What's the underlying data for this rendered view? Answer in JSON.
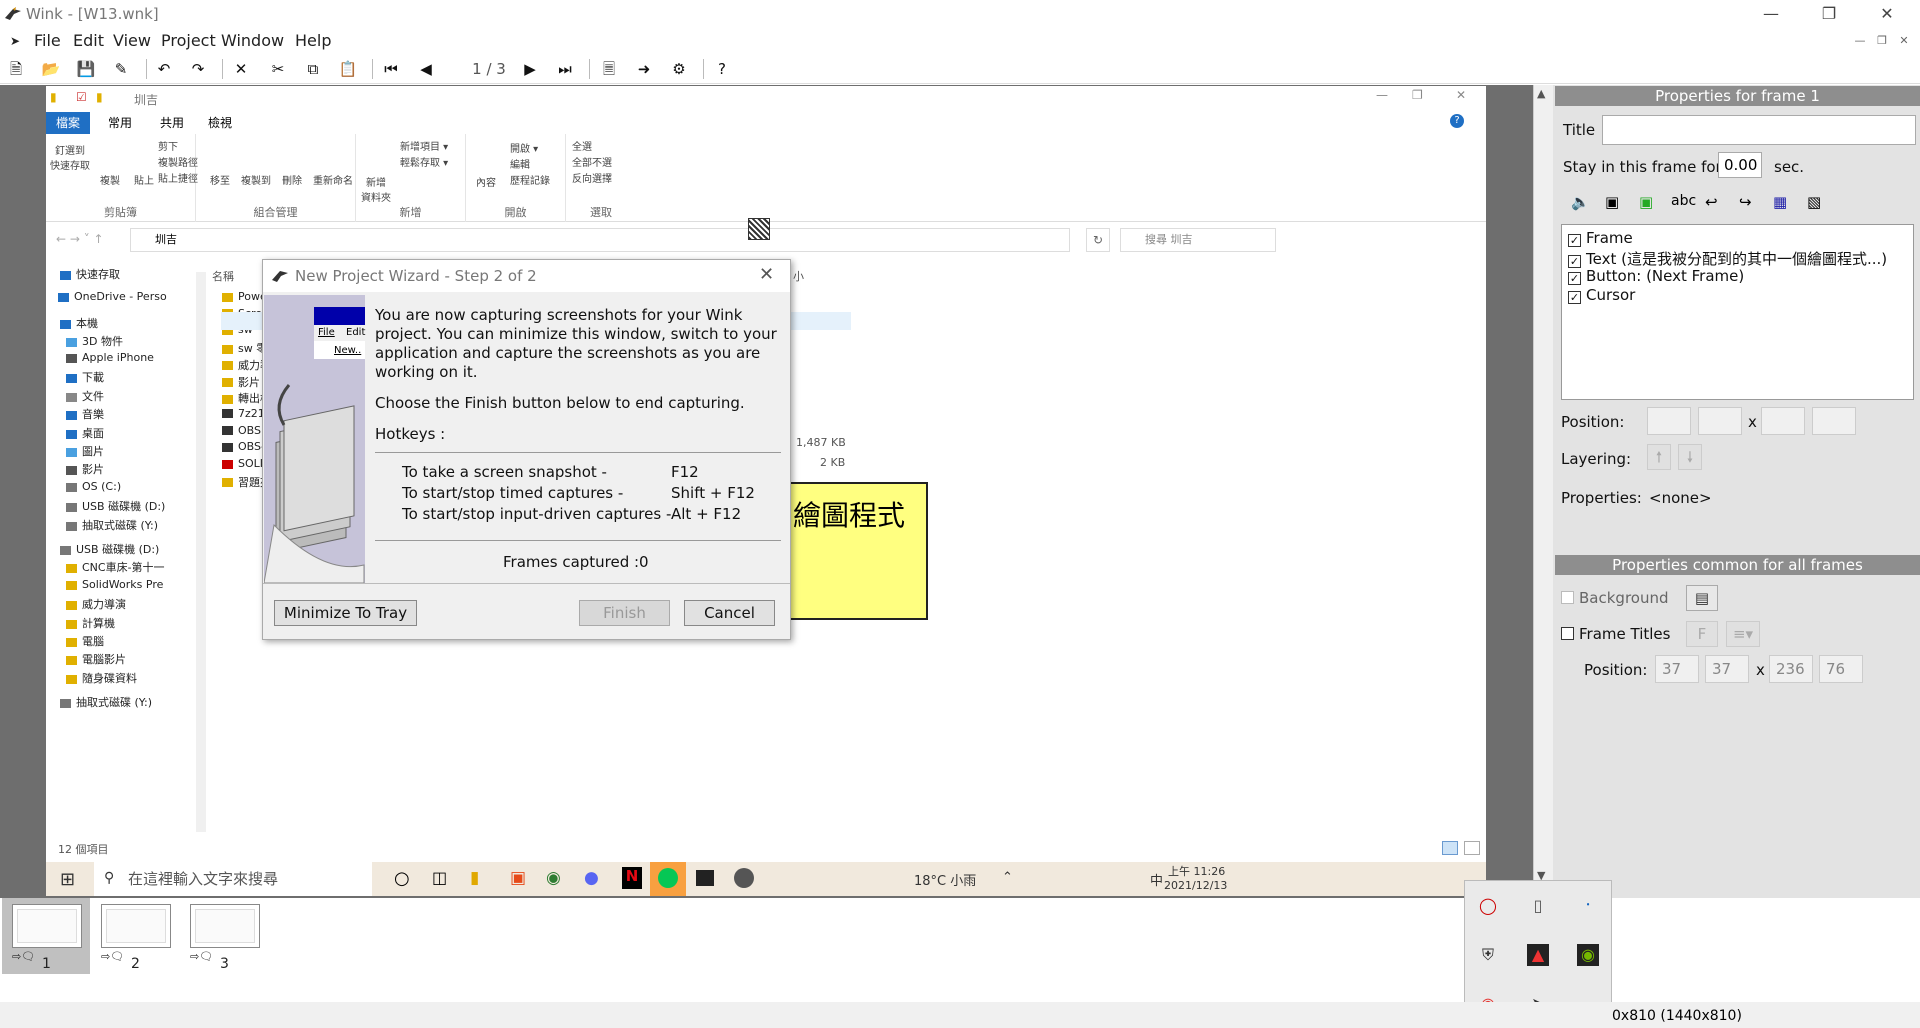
{
  "app": {
    "title": "Wink - [W13.wnk]",
    "menu": [
      "File",
      "Edit",
      "View",
      "Project",
      "Window",
      "Help"
    ],
    "frame_counter": "1 / 3"
  },
  "explorer": {
    "path_title": "圳吉",
    "tabs": [
      "檔案",
      "常用",
      "共用",
      "檢視"
    ],
    "ribbon": {
      "clipboard": {
        "label": "剪貼簿",
        "pin": "釘選到\n快速存取",
        "copy": "複製",
        "paste": "貼上",
        "cut": "剪下",
        "copy_path": "複製路徑",
        "paste_shortcut": "貼上捷徑"
      },
      "organize": {
        "label": "組合管理",
        "move_to": "移至",
        "copy_to": "複製到",
        "delete": "刪除",
        "rename": "重新命名"
      },
      "new": {
        "label": "新增",
        "new_folder": "新增\n資料夾",
        "new_item": "新增項目 ▾",
        "easy_access": "輕鬆存取 ▾"
      },
      "open": {
        "label": "開啟",
        "properties": "內容",
        "open": "開啟 ▾",
        "edit": "編輯",
        "history": "歷程記錄"
      },
      "select": {
        "label": "選取",
        "select_all": "全選",
        "select_none": "全部不選",
        "invert": "反向選擇"
      }
    },
    "address": "圳吉",
    "search_placeholder": "搜尋 圳吉",
    "column_name": "名稱",
    "column_size": "小",
    "nav": [
      "快速存取",
      "OneDrive - Perso",
      "本機",
      "3D 物件",
      "Apple iPhone",
      "下載",
      "文件",
      "音樂",
      "桌面",
      "圖片",
      "影片",
      "OS (C:)",
      "USB 磁碟機 (D:)",
      "抽取式磁碟 (Y:)",
      "USB 磁碟機 (D:)",
      "CNC車床-第十一",
      "SolidWorks Pre",
      "威力導演",
      "計算機",
      "電腦",
      "電腦影片",
      "隨身碟資料",
      "抽取式磁碟 (Y:)"
    ],
    "files": [
      "Powe",
      "Scree",
      "sw",
      "sw 零",
      "威力導",
      "影片",
      "轉出檔",
      "7z210",
      "OBS S",
      "OBS-",
      "SOLID",
      "習題夾"
    ],
    "sizes": [
      "1,487 KB",
      "2 KB"
    ],
    "item_count": "12 個項目"
  },
  "wizard": {
    "title": "New Project Wizard - Step 2 of 2",
    "para1": "You are now capturing screenshots for your Wink project. You can minimize this window, switch to your application and capture the screenshots as you are working on it.",
    "para2": "Choose the Finish button below to end capturing.",
    "hotkeys_label": "Hotkeys :",
    "hotkeys": [
      {
        "action": "To take a screen snapshot -",
        "key": "F12"
      },
      {
        "action": "To start/stop timed captures -",
        "key": "Shift + F12"
      },
      {
        "action": "To start/stop input-driven captures -",
        "key": "Alt + F12"
      }
    ],
    "frames_label": "Frames captured :",
    "frames_value": "0",
    "buttons": {
      "minimize": "Minimize To Tray",
      "finish": "Finish",
      "cancel": "Cancel"
    },
    "side_menu": [
      "File",
      "Edit",
      "New.."
    ]
  },
  "note_text": "繪圖程式",
  "taskbar": {
    "search_placeholder": "在這裡輸入文字來搜尋",
    "weather": "18°C 小雨",
    "ime": "中",
    "time": "上午 11:26",
    "date": "2021/12/13"
  },
  "panel": {
    "frame_header": "Properties for frame 1",
    "title_label": "Title",
    "title_value": "",
    "stay_label": "Stay in this frame for",
    "stay_value": "0.00",
    "stay_unit": "sec.",
    "items": [
      {
        "label": "Frame",
        "checked": true
      },
      {
        "label": "Text (這是我被分配到的其中一個繪圖程式...)",
        "checked": true
      },
      {
        "label": "Button: (Next Frame)",
        "checked": true
      },
      {
        "label": "Cursor",
        "checked": true
      }
    ],
    "position_label": "Position:",
    "x_sep": "x",
    "layering_label": "Layering:",
    "properties_label": "Properties:",
    "properties_value": "<none>",
    "common_header": "Properties common for all frames",
    "background_label": "Background",
    "frame_titles_label": "Frame Titles",
    "common_position_label": "Position:",
    "common_position": [
      "37",
      "37",
      "236",
      "76"
    ]
  },
  "filmstrip": {
    "frames": [
      "1",
      "2",
      "3"
    ],
    "selected": "1"
  },
  "status": {
    "text": "0x810 (1440x810)"
  }
}
